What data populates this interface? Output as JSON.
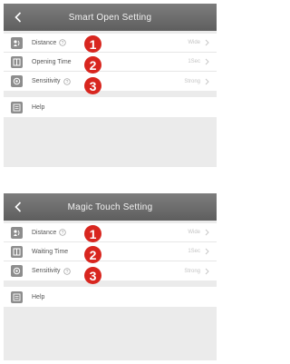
{
  "screens": [
    {
      "title": "Smart Open Setting",
      "rows": [
        {
          "label": "Distance",
          "value": "Wide",
          "icon": "distance-icon"
        },
        {
          "label": "Opening Time",
          "value": "1Sec",
          "icon": "opening-time-icon"
        },
        {
          "label": "Sensitivity",
          "value": "Strong",
          "icon": "sensitivity-icon"
        }
      ],
      "help_label": "Help",
      "markers": [
        "1",
        "2",
        "3"
      ]
    },
    {
      "title": "Magic Touch Setting",
      "rows": [
        {
          "label": "Distance",
          "value": "Wide",
          "icon": "distance-icon"
        },
        {
          "label": "Waiting Time",
          "value": "1Sec",
          "icon": "waiting-time-icon"
        },
        {
          "label": "Sensitivity",
          "value": "Strong",
          "icon": "sensitivity-icon"
        }
      ],
      "help_label": "Help",
      "markers": [
        "1",
        "2",
        "3"
      ]
    }
  ],
  "colors": {
    "titlebar": "#6b6b6b",
    "marker": "#d8261f",
    "row_icon": "#8d8d8d"
  }
}
